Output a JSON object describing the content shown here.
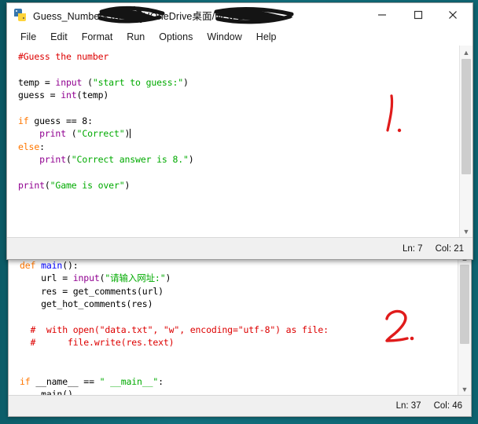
{
  "window_front": {
    "title": "Guess_Numbers.py - C:/Users/███/OneDrive████/桌面/New Learnin...",
    "title_visible": "Guess_Numbers.py - C:/U",
    "title_part2": "OneDrive",
    "title_part3": "桌面/New Learnin...",
    "icon": "python-file-icon",
    "menus": [
      "File",
      "Edit",
      "Format",
      "Run",
      "Options",
      "Window",
      "Help"
    ],
    "controls": {
      "minimize": "minimize-icon",
      "maximize": "maximize-icon",
      "close": "close-icon"
    },
    "status": {
      "line_label": "Ln: 7",
      "col_label": "Col: 21"
    },
    "code_lines": [
      [
        {
          "t": "#Guess the number",
          "c": "cmt"
        }
      ],
      [],
      [
        {
          "t": "temp = ",
          "c": ""
        },
        {
          "t": "input",
          "c": "bi"
        },
        {
          "t": " (",
          "c": ""
        },
        {
          "t": "\"start to guess:\"",
          "c": "str"
        },
        {
          "t": ")",
          "c": ""
        }
      ],
      [
        {
          "t": "guess = ",
          "c": ""
        },
        {
          "t": "int",
          "c": "bi"
        },
        {
          "t": "(temp)",
          "c": ""
        }
      ],
      [],
      [
        {
          "t": "if",
          "c": "kw"
        },
        {
          "t": " guess == 8:",
          "c": ""
        }
      ],
      [
        {
          "t": "    ",
          "c": ""
        },
        {
          "t": "print",
          "c": "bi"
        },
        {
          "t": " (",
          "c": ""
        },
        {
          "t": "\"Correct\"",
          "c": "str"
        },
        {
          "t": ")",
          "c": ""
        },
        {
          "t": "|",
          "c": "caret"
        }
      ],
      [
        {
          "t": "else",
          "c": "kw"
        },
        {
          "t": ":",
          "c": ""
        }
      ],
      [
        {
          "t": "    ",
          "c": ""
        },
        {
          "t": "print",
          "c": "bi"
        },
        {
          "t": "(",
          "c": ""
        },
        {
          "t": "\"Correct answer is 8.\"",
          "c": "str"
        },
        {
          "t": ")",
          "c": ""
        }
      ],
      [],
      [
        {
          "t": "print",
          "c": "bi"
        },
        {
          "t": "(",
          "c": ""
        },
        {
          "t": "\"Game is over\"",
          "c": "str"
        },
        {
          "t": ")",
          "c": ""
        }
      ]
    ]
  },
  "window_back": {
    "status": {
      "line_label": "Ln: 37",
      "col_label": "Col: 46"
    },
    "code_lines": [
      [
        {
          "t": "def",
          "c": "kw"
        },
        {
          "t": " ",
          "c": ""
        },
        {
          "t": "main",
          "c": "def"
        },
        {
          "t": "():",
          "c": ""
        }
      ],
      [
        {
          "t": "    url = ",
          "c": ""
        },
        {
          "t": "input",
          "c": "bi"
        },
        {
          "t": "(",
          "c": ""
        },
        {
          "t": "\"请输入网址:\"",
          "c": "str"
        },
        {
          "t": ")",
          "c": ""
        }
      ],
      [
        {
          "t": "    res = get_comments(url)",
          "c": ""
        }
      ],
      [
        {
          "t": "    get_hot_comments(res)",
          "c": ""
        }
      ],
      [],
      [
        {
          "t": "  #  with open(\"data.txt\", \"w\", encoding=\"utf-8\") as file:",
          "c": "cmt"
        }
      ],
      [
        {
          "t": "  #      file.write(res.text)",
          "c": "cmt"
        }
      ],
      [],
      [],
      [
        {
          "t": "if",
          "c": "kw"
        },
        {
          "t": " __name__ == ",
          "c": ""
        },
        {
          "t": "\" __main__\"",
          "c": "str"
        },
        {
          "t": ":",
          "c": ""
        }
      ],
      [
        {
          "t": "    main()",
          "c": ""
        }
      ]
    ]
  },
  "annotations": [
    {
      "name": "handwritten-marker-1",
      "text": "1.",
      "color": "#e01b1b"
    },
    {
      "name": "handwritten-marker-2",
      "text": "2.",
      "color": "#e01b1b"
    }
  ],
  "colors": {
    "desktop": "#0e6672",
    "keyword": "#ff7700",
    "builtin": "#900090",
    "string": "#00aa00",
    "comment": "#dd0000",
    "definition": "#0000ff",
    "annotation": "#e01b1b",
    "statusbar": "#f0f0f0"
  }
}
